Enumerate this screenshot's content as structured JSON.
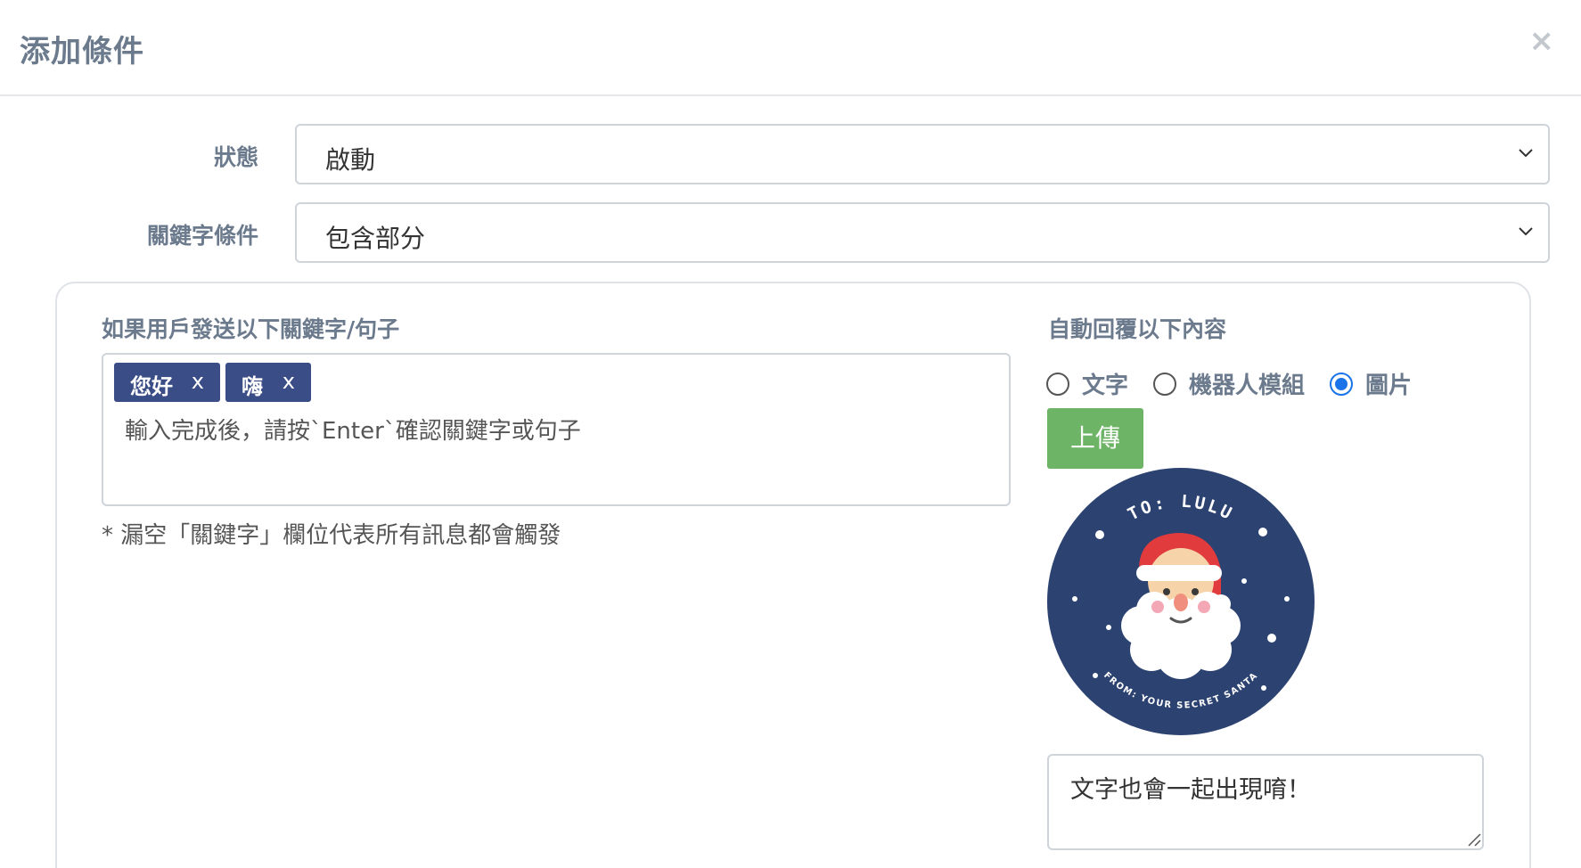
{
  "modal": {
    "title": "添加條件",
    "close_label": "×"
  },
  "form": {
    "status": {
      "label": "狀態",
      "value": "啟動"
    },
    "keyword_condition": {
      "label": "關鍵字條件",
      "value": "包含部分"
    }
  },
  "keywords": {
    "title": "如果用戶發送以下關鍵字/句子",
    "tags": [
      {
        "label": "您好",
        "remove": "x"
      },
      {
        "label": "嗨",
        "remove": "x"
      }
    ],
    "placeholder": "輸入完成後，請按`Enter`確認關鍵字或句子",
    "hint": "* 漏空「關鍵字」欄位代表所有訊息都會觸發"
  },
  "reply": {
    "title": "自動回覆以下內容",
    "options": [
      {
        "label": "文字",
        "checked": false
      },
      {
        "label": "機器人模組",
        "checked": false
      },
      {
        "label": "圖片",
        "checked": true
      }
    ],
    "upload_label": "上傳",
    "image": {
      "top_text": "TO: LULU",
      "bottom_text": "FROM: YOUR SECRET SANTA",
      "bg_color": "#2c4270"
    },
    "text_value": "文字也會一起出現唷！"
  }
}
